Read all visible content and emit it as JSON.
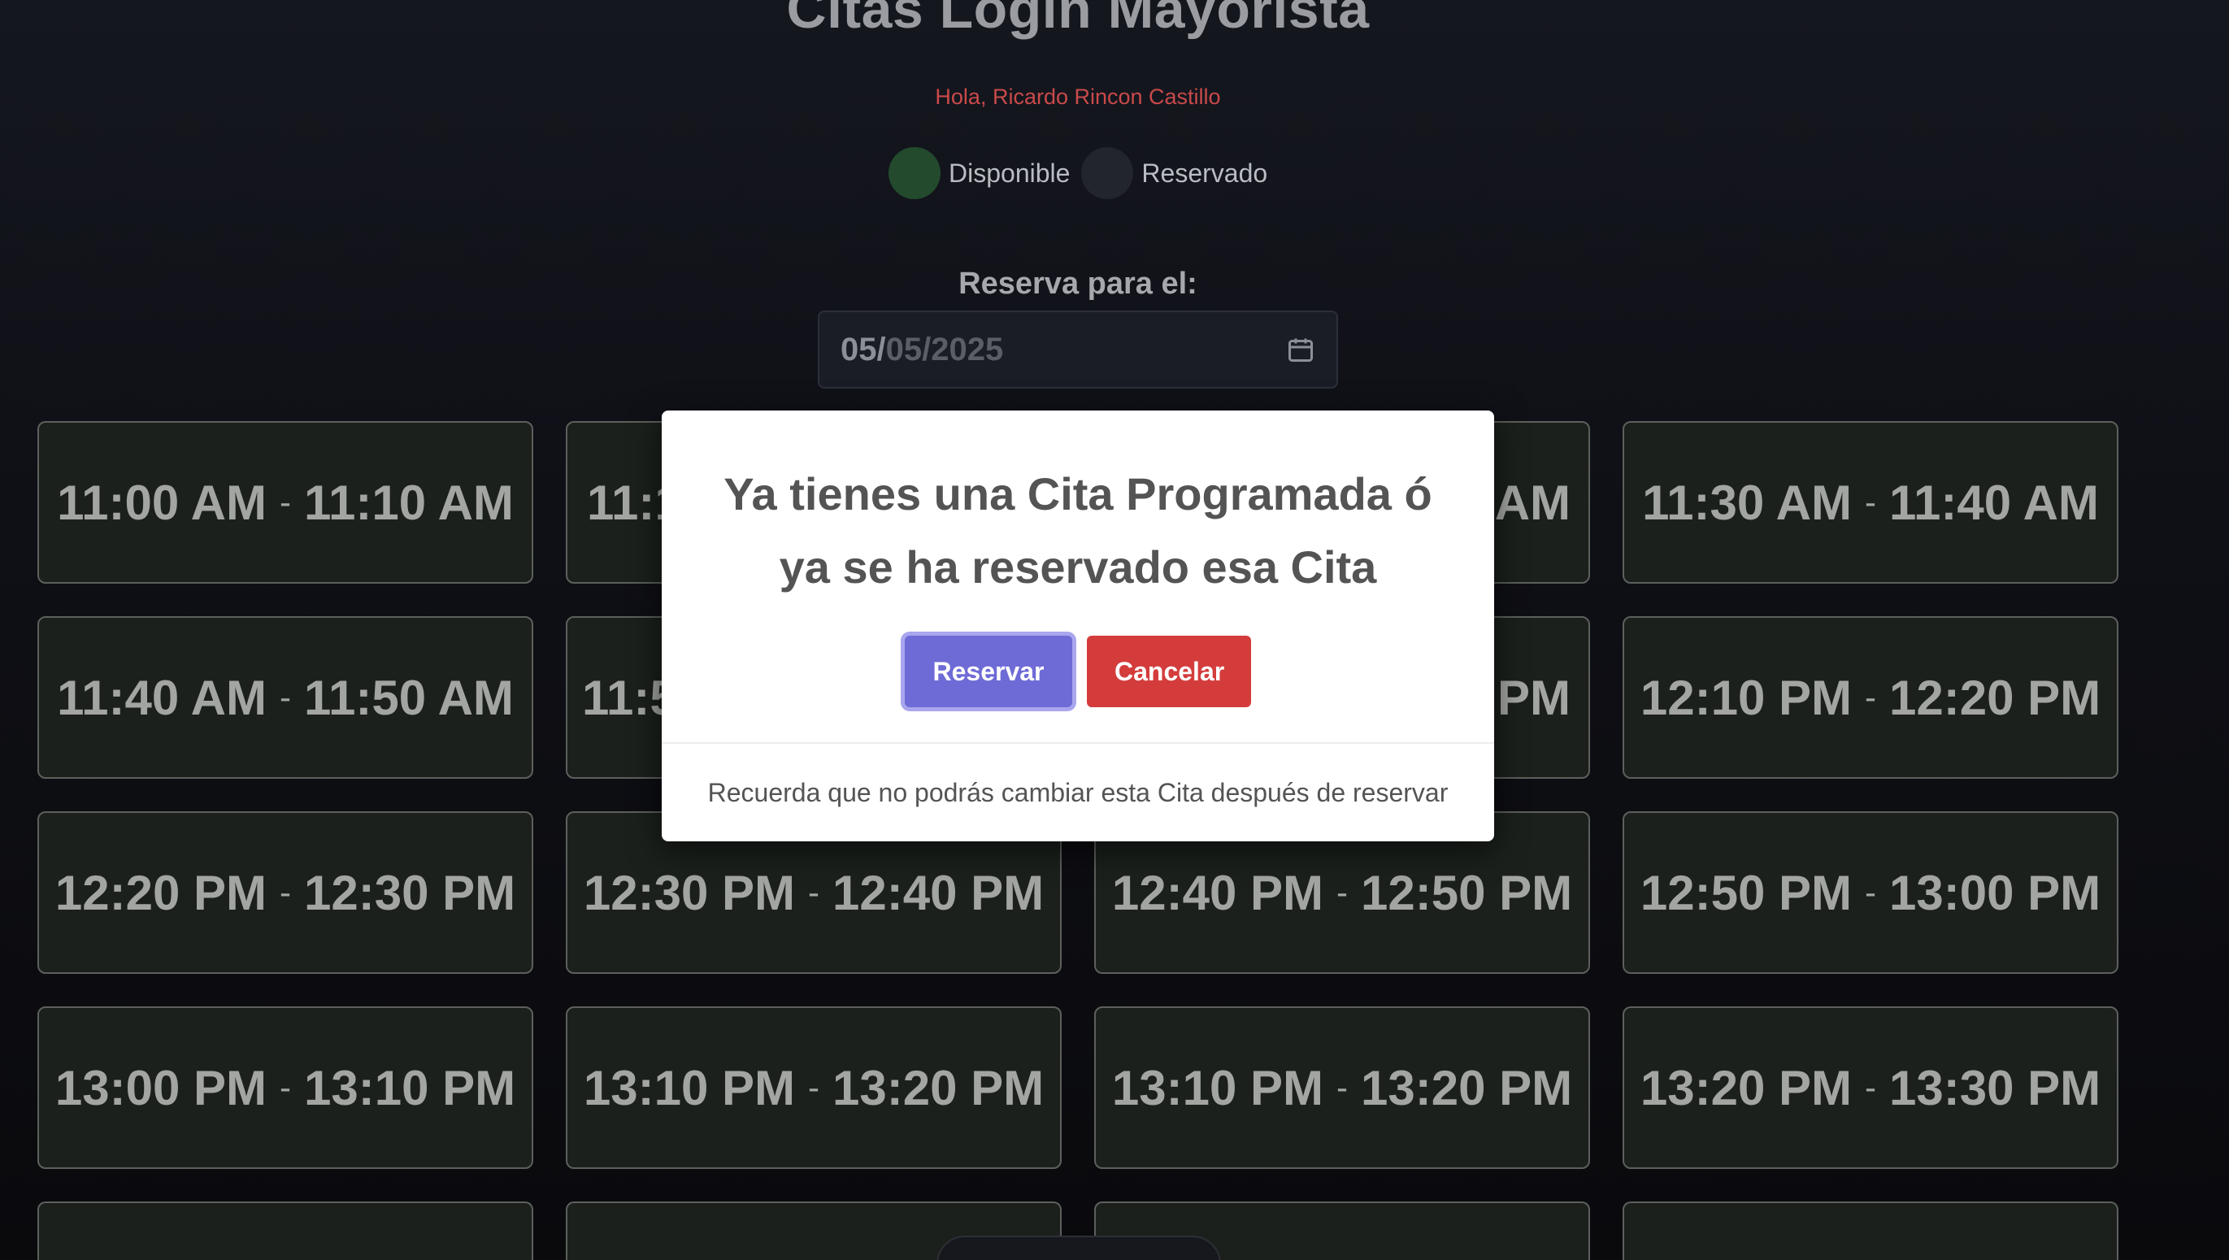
{
  "header": {
    "title": "Citas Login Mayorista",
    "greeting": "Hola, Ricardo Rincon Castillo"
  },
  "legend": {
    "available": {
      "label": "Disponible",
      "color": "#234a2d"
    },
    "reserved": {
      "label": "Reservado",
      "color": "#22252e"
    }
  },
  "date_picker": {
    "label": "Reserva para el:",
    "day": "05/",
    "rest": "05/2025",
    "icon": "calendar-icon"
  },
  "slots": [
    {
      "start": "11:00 AM",
      "sep": "-",
      "end": "11:10 AM"
    },
    {
      "start": "11:1",
      "sep": "",
      "end": ""
    },
    {
      "start": "",
      "sep": "",
      "end": "AM"
    },
    {
      "start": "11:30 AM",
      "sep": "-",
      "end": "11:40 AM"
    },
    {
      "start": "11:40 AM",
      "sep": "-",
      "end": "11:50 AM"
    },
    {
      "start": "11:5",
      "sep": "",
      "end": ""
    },
    {
      "start": "",
      "sep": "",
      "end": "PM"
    },
    {
      "start": "12:10 PM",
      "sep": "-",
      "end": "12:20 PM"
    },
    {
      "start": "12:20 PM",
      "sep": "-",
      "end": "12:30 PM"
    },
    {
      "start": "12:30 PM",
      "sep": "-",
      "end": "12:40 PM"
    },
    {
      "start": "12:40 PM",
      "sep": "-",
      "end": "12:50 PM"
    },
    {
      "start": "12:50 PM",
      "sep": "-",
      "end": "13:00 PM"
    },
    {
      "start": "13:00 PM",
      "sep": "-",
      "end": "13:10 PM"
    },
    {
      "start": "13:10 PM",
      "sep": "-",
      "end": "13:20 PM"
    },
    {
      "start": "13:10 PM",
      "sep": "-",
      "end": "13:20 PM"
    },
    {
      "start": "13:20 PM",
      "sep": "-",
      "end": "13:30 PM"
    },
    {
      "start": "",
      "sep": "",
      "end": ""
    },
    {
      "start": "",
      "sep": "",
      "end": ""
    },
    {
      "start": "",
      "sep": "",
      "end": ""
    },
    {
      "start": "",
      "sep": "",
      "end": ""
    }
  ],
  "modal": {
    "title": "Ya tienes una Cita Programada ó ya se ha reservado esa Cita",
    "confirm_label": "Reservar",
    "cancel_label": "Cancelar",
    "footer": "Recuerda que no podrás cambiar esta Cita después de reservar",
    "confirm_color": "#6e6ad6",
    "cancel_color": "#d43c3c"
  }
}
